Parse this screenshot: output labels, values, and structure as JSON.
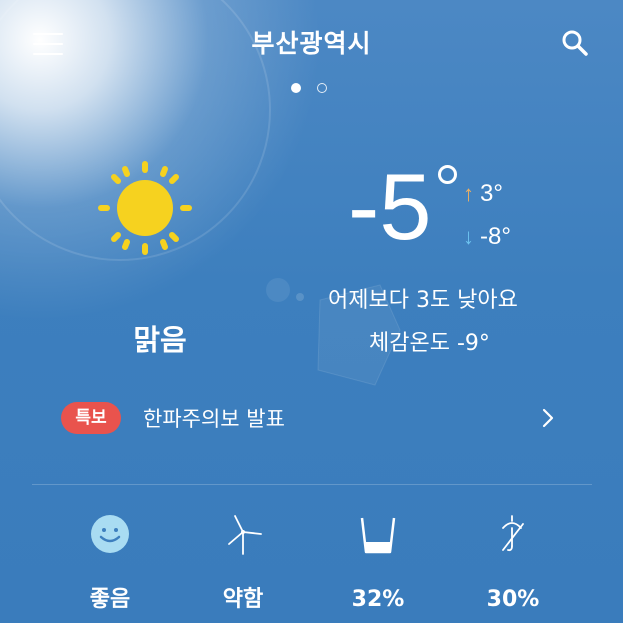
{
  "header": {
    "city": "부산광역시",
    "page_count": 2,
    "active_page": 1
  },
  "current": {
    "icon": "sun-icon",
    "condition": "맑음",
    "temperature": "-5",
    "high": "3°",
    "low": "-8°",
    "comparison": "어제보다 3도 낮아요",
    "feels_like": "체감온도 -9°"
  },
  "alert": {
    "badge": "특보",
    "text": "한파주의보 발표"
  },
  "stats": [
    {
      "icon": "smile-face-icon",
      "value": "좋음"
    },
    {
      "icon": "wind-turbine-icon",
      "value": "약함"
    },
    {
      "icon": "water-cup-icon",
      "value": "32%"
    },
    {
      "icon": "umbrella-off-icon",
      "value": "30%"
    }
  ],
  "colors": {
    "background": "#3d7fbe",
    "sun": "#f6d21f",
    "badge": "#e9534d",
    "arrow_up": "#f0b060",
    "arrow_down": "#6ec3f0",
    "face": "#a9dcf2"
  }
}
